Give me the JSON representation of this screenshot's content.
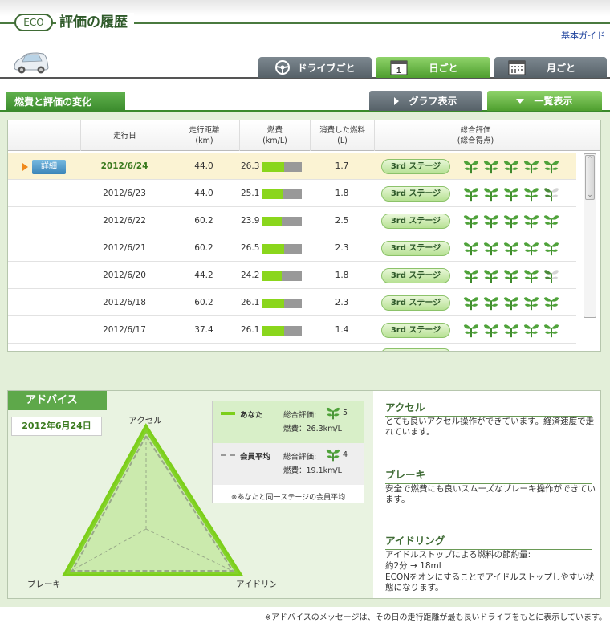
{
  "header": {
    "eco_badge": "ECO",
    "title": "評価の履歴",
    "guide_link": "基本ガイド"
  },
  "tabs": [
    {
      "label": "ドライブごと",
      "icon": "steering-wheel-icon",
      "active": false
    },
    {
      "label": "日ごと",
      "icon": "calendar-day-icon",
      "active": true
    },
    {
      "label": "月ごと",
      "icon": "calendar-month-icon",
      "active": false
    }
  ],
  "section": {
    "title": "燃費と評価の変化",
    "graph_button": "グラフ表示",
    "list_button": "一覧表示"
  },
  "table": {
    "headers": {
      "date": "走行日",
      "distance": "走行距離",
      "distance_unit": "(km)",
      "economy": "燃費",
      "economy_unit": "(km/L)",
      "fuel": "消費した燃料",
      "fuel_unit": "(L)",
      "rating": "総合評価",
      "rating_unit": "(総合得点)"
    },
    "detail_label": "詳細",
    "rows": [
      {
        "date": "2012/6/24",
        "distance": "44.0",
        "economy": "26.3",
        "fuel": "1.7",
        "stage": "3rd ステージ",
        "sprouts": 5,
        "bar": 0.55,
        "selected": true
      },
      {
        "date": "2012/6/23",
        "distance": "44.0",
        "economy": "25.1",
        "fuel": "1.8",
        "stage": "3rd ステージ",
        "sprouts": 4.5,
        "bar": 0.52,
        "selected": false
      },
      {
        "date": "2012/6/22",
        "distance": "60.2",
        "economy": "23.9",
        "fuel": "2.5",
        "stage": "3rd ステージ",
        "sprouts": 5,
        "bar": 0.5,
        "selected": false
      },
      {
        "date": "2012/6/21",
        "distance": "60.2",
        "economy": "26.5",
        "fuel": "2.3",
        "stage": "3rd ステージ",
        "sprouts": 5,
        "bar": 0.56,
        "selected": false
      },
      {
        "date": "2012/6/20",
        "distance": "44.2",
        "economy": "24.2",
        "fuel": "1.8",
        "stage": "3rd ステージ",
        "sprouts": 4.5,
        "bar": 0.5,
        "selected": false
      },
      {
        "date": "2012/6/18",
        "distance": "60.2",
        "economy": "26.1",
        "fuel": "2.3",
        "stage": "3rd ステージ",
        "sprouts": 5,
        "bar": 0.55,
        "selected": false
      },
      {
        "date": "2012/6/17",
        "distance": "37.4",
        "economy": "26.1",
        "fuel": "1.4",
        "stage": "3rd ステージ",
        "sprouts": 5,
        "bar": 0.55,
        "selected": false
      }
    ]
  },
  "advice": {
    "title": "アドバイス",
    "date": "2012年6月24日",
    "radar_labels": {
      "top": "アクセル",
      "left": "ブレーキ",
      "right": "アイドリング"
    },
    "legend": {
      "you_label": "あなた",
      "you_rating_label": "総合評価:",
      "you_rating": "5",
      "you_economy": "燃費：26.3km/L",
      "avg_label": "会員平均",
      "avg_rating_label": "総合評価:",
      "avg_rating": "4",
      "avg_economy": "燃費：19.1km/L",
      "note": "※あなたと同一ステージの会員平均"
    },
    "items": [
      {
        "heading": "アクセル",
        "text": "とても良いアクセル操作ができています。経済速度で走れています。"
      },
      {
        "heading": "ブレーキ",
        "text": "安全で燃費にも良いスムーズなブレーキ操作ができています。"
      },
      {
        "heading": "アイドリング",
        "lines": [
          "アイドルストップによる燃料の節約量:",
          "約2分 → 18ml",
          "ECONをオンにすることでアイドルストップしやすい状態になります。"
        ]
      }
    ],
    "footnote": "※アドバイスのメッセージは、その日の走行距離が最も長いドライブをもとに表示しています。"
  },
  "colors": {
    "brand_green": "#3a8a2c",
    "bar_fill": "#8ad61c",
    "selected_row": "#fbf3d3"
  }
}
